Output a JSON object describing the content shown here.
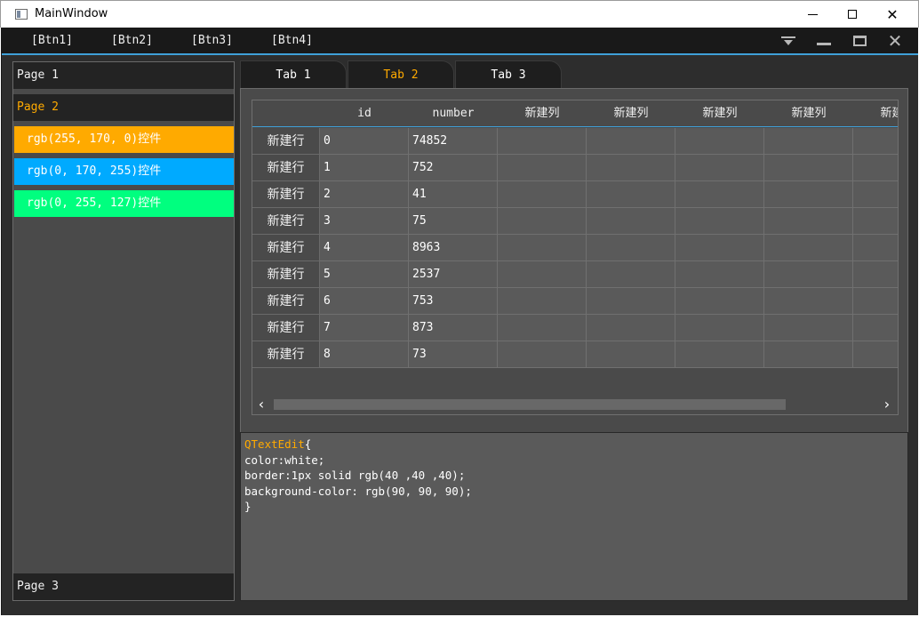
{
  "window": {
    "title": "MainWindow"
  },
  "menubar": {
    "buttons": [
      "[Btn1]",
      "[Btn2]",
      "[Btn3]",
      "[Btn4]"
    ],
    "accent_color": "#3fa0d8"
  },
  "left_panel": {
    "pages": [
      "Page 1",
      "Page 2",
      "Page 3"
    ],
    "active_page": "Page 2",
    "items": [
      {
        "label": "rgb(255, 170, 0)控件",
        "color": "#ffaa00"
      },
      {
        "label": "rgb(0, 170, 255)控件",
        "color": "#00aaff"
      },
      {
        "label": "rgb(0, 255, 127)控件",
        "color": "#00ff7f"
      }
    ]
  },
  "tabs": {
    "labels": [
      "Tab 1",
      "Tab 2",
      "Tab 3"
    ],
    "active": "Tab 2",
    "active_color": "#ffaa00"
  },
  "table": {
    "columns": [
      "id",
      "number",
      "新建列",
      "新建列",
      "新建列",
      "新建列",
      "新建列"
    ],
    "row_header": "新建行",
    "rows": [
      [
        "0",
        "74852"
      ],
      [
        "1",
        "752"
      ],
      [
        "2",
        "41"
      ],
      [
        "3",
        "75"
      ],
      [
        "4",
        "8963"
      ],
      [
        "5",
        "2537"
      ],
      [
        "6",
        "753"
      ],
      [
        "7",
        "873"
      ],
      [
        "8",
        "73"
      ]
    ]
  },
  "text_edit": {
    "selector": "QTextEdit",
    "open_brace": "{",
    "lines": [
      "color:white;",
      "border:1px solid rgb(40 ,40 ,40);",
      "background-color: rgb(90, 90, 90);",
      "}"
    ]
  }
}
